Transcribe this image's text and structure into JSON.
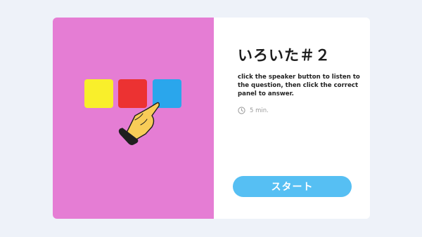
{
  "game": {
    "title": "いろいた＃２",
    "instructions": "click the speaker button to listen to the question, then click the correct panel to answer.",
    "duration": "5 min.",
    "start_label": "スタート"
  },
  "colors": {
    "page_bg": "#eef2f9",
    "left_pane": "#e57dd4",
    "panel_yellow": "#f9ef2b",
    "panel_red": "#ec3232",
    "panel_blue": "#2aa6ec",
    "hand": "#f8cc58",
    "sleeve": "#1f1f1f",
    "button": "#56bff3"
  },
  "icons": [
    "color-panel",
    "pointing-hand-icon",
    "clock-icon"
  ]
}
